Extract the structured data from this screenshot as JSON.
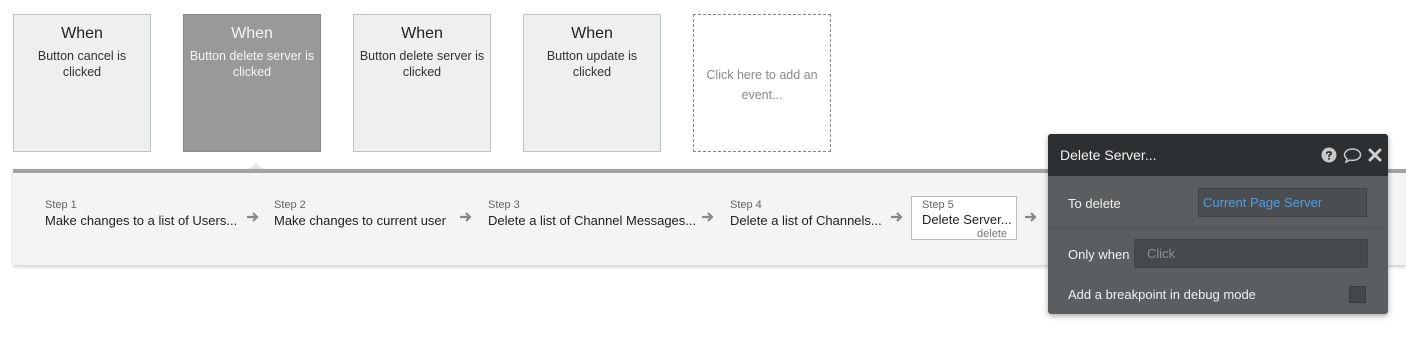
{
  "events": [
    {
      "when": "When",
      "desc": "Button cancel is clicked"
    },
    {
      "when": "When",
      "desc": "Button delete server is clicked"
    },
    {
      "when": "When",
      "desc": "Button delete server is clicked"
    },
    {
      "when": "When",
      "desc": "Button update is clicked"
    }
  ],
  "add_event": "Click here to add an event...",
  "steps": [
    {
      "num": "Step 1",
      "name": "Make changes to a list of Users..."
    },
    {
      "num": "Step 2",
      "name": "Make changes to current user"
    },
    {
      "num": "Step 3",
      "name": "Delete a list of Channel Messages..."
    },
    {
      "num": "Step 4",
      "name": "Delete a list of Channels..."
    },
    {
      "num": "Step 5",
      "name": "Delete Server...",
      "tag": "delete"
    }
  ],
  "panel": {
    "title": "Delete Server...",
    "to_delete_label": "To delete",
    "to_delete_value": "Current Page Server",
    "only_when_label": "Only when",
    "only_when_placeholder": "Click",
    "breakpoint_label": "Add a breakpoint in debug mode",
    "icons": [
      "help-icon",
      "comment-icon",
      "close-icon"
    ],
    "link_color": "#4a9eea"
  }
}
